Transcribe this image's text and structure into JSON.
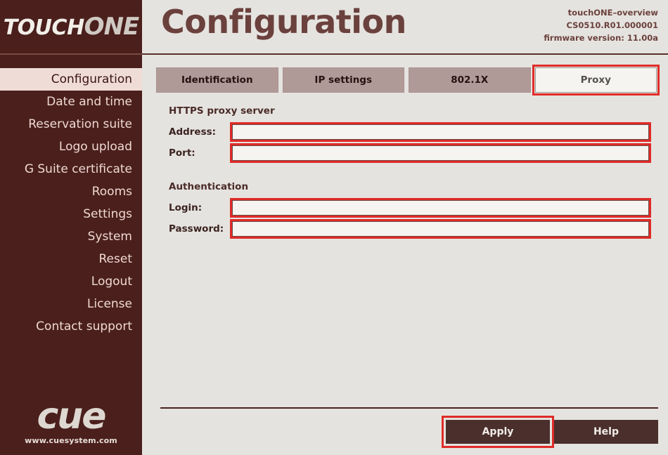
{
  "brand": {
    "name_part1": "TOUCH",
    "name_part2": "ONE"
  },
  "header": {
    "title": "Configuration",
    "device_name": "touchONE–overview",
    "serial": "CS0510.R01.000001",
    "firmware": "firmware version: 11.00a"
  },
  "sidebar": {
    "items": [
      {
        "label": "Configuration",
        "active": true
      },
      {
        "label": "Date and time",
        "active": false
      },
      {
        "label": "Reservation suite",
        "active": false
      },
      {
        "label": "Logo upload",
        "active": false
      },
      {
        "label": "G Suite certificate",
        "active": false
      },
      {
        "label": "Rooms",
        "active": false
      },
      {
        "label": "Settings",
        "active": false
      },
      {
        "label": "System",
        "active": false
      },
      {
        "label": "Reset",
        "active": false
      },
      {
        "label": "Logout",
        "active": false
      },
      {
        "label": "License",
        "active": false
      },
      {
        "label": "Contact support",
        "active": false
      }
    ],
    "logo": {
      "mark": "cue",
      "url": "www.cuesystem.com"
    }
  },
  "tabs": [
    {
      "label": "Identification",
      "active": false
    },
    {
      "label": "IP settings",
      "active": false
    },
    {
      "label": "802.1X",
      "active": false
    },
    {
      "label": "Proxy",
      "active": true
    }
  ],
  "form": {
    "proxy_section_title": "HTTPS proxy server",
    "auth_section_title": "Authentication",
    "fields": {
      "address": {
        "label": "Address:",
        "value": "",
        "placeholder": ""
      },
      "port": {
        "label": "Port:",
        "value": "",
        "placeholder": ""
      },
      "login": {
        "label": "Login:",
        "value": "",
        "placeholder": ""
      },
      "password": {
        "label": "Password:",
        "value": "",
        "placeholder": ""
      }
    }
  },
  "footer": {
    "apply_label": "Apply",
    "help_label": "Help"
  },
  "colors": {
    "sidebar_bg": "#4a1f1c",
    "content_bg": "#e5e3df",
    "accent_red": "#e02b28",
    "tab_inactive": "#b09a98",
    "button_bg": "#4a2f2c",
    "title_color": "#6b413d"
  }
}
